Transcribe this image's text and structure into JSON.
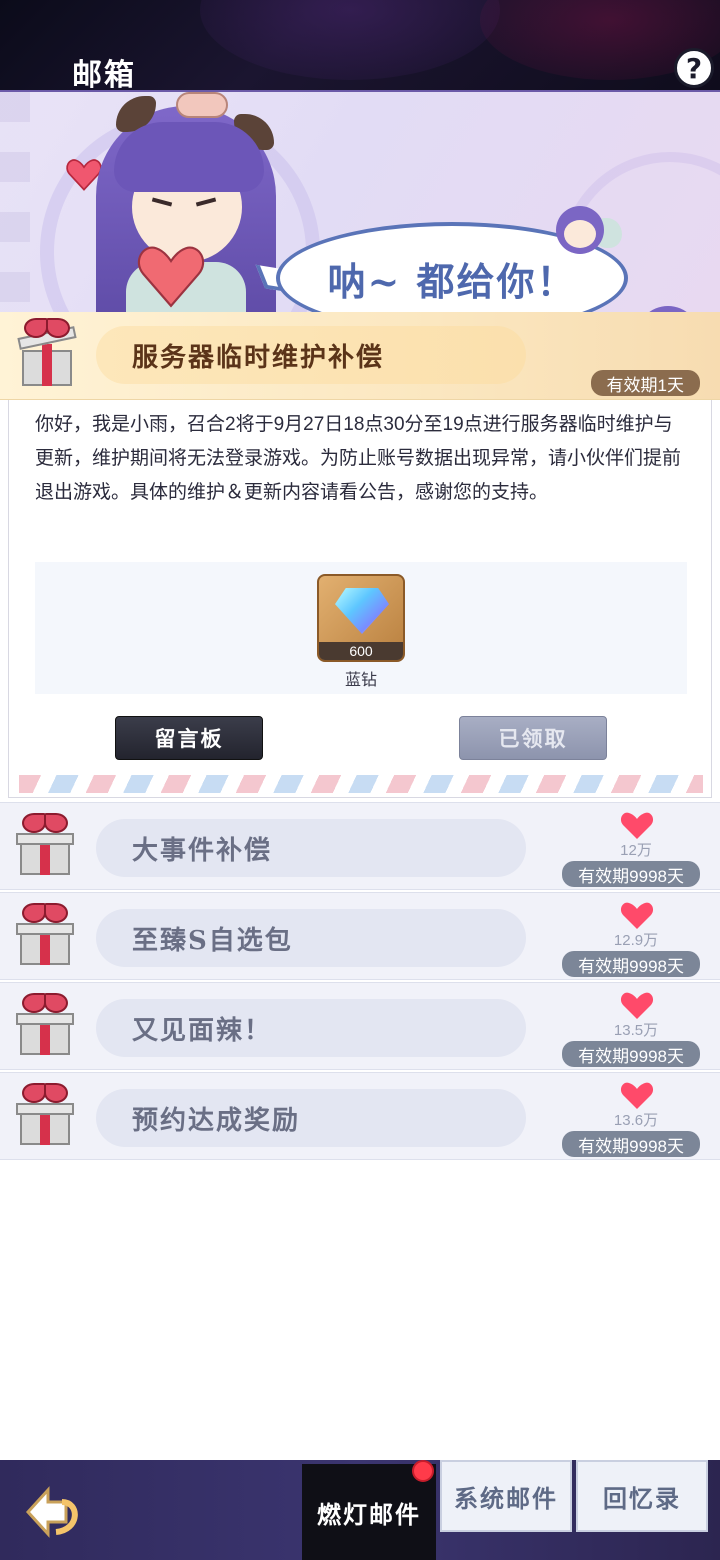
{
  "header": {
    "title": "邮箱",
    "help_label": "?"
  },
  "banner": {
    "speech": "呐~ 都给你！"
  },
  "open_mail": {
    "title": "服务器临时维护补偿",
    "expire": "有效期1天",
    "body": "你好，我是小雨，召合2将于9月27日18点30分至19点进行服务器临时维护与更新，维护期间将无法登录游戏。为防止账号数据出现异常，请小伙伴们提前退出游戏。具体的维护＆更新内容请看公告，感谢您的支持。",
    "reward": {
      "count": "600",
      "name": "蓝钻",
      "icon": "blue-diamond-icon"
    },
    "buttons": {
      "board": "留言板",
      "claimed": "已领取"
    }
  },
  "mails": [
    {
      "title": "大事件补偿",
      "likes": "12万",
      "expire": "有效期9998天"
    },
    {
      "title": "至臻S自选包",
      "likes": "12.9万",
      "expire": "有效期9998天"
    },
    {
      "title": "又见面辣！",
      "likes": "13.5万",
      "expire": "有效期9998天"
    },
    {
      "title": "预约达成奖励",
      "likes": "13.6万",
      "expire": "有效期9998天"
    }
  ],
  "tabs": {
    "active": "燃灯邮件",
    "system": "系统邮件",
    "memory": "回忆录"
  },
  "colors": {
    "heart": "#ff4a6a",
    "accent_gold": "#8b6c4e",
    "badge_gray": "#7c8698"
  }
}
